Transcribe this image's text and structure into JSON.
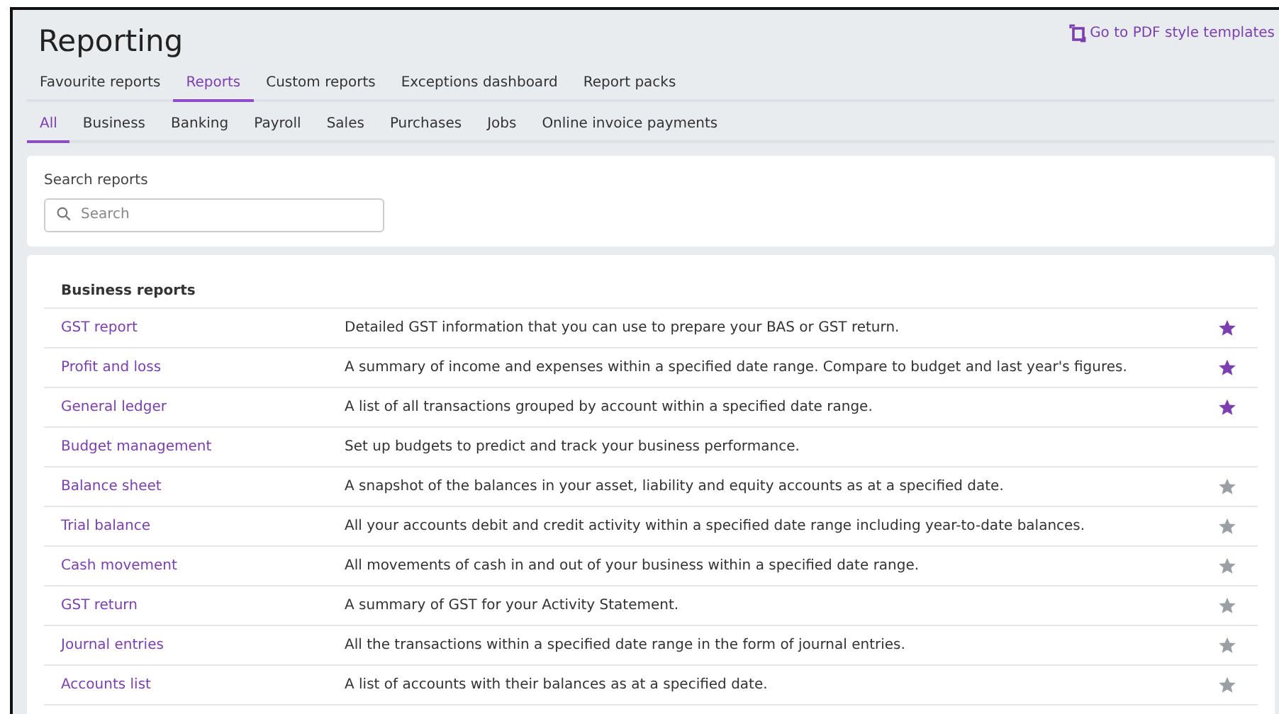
{
  "title": "Reporting",
  "pdf_link": "Go to PDF style templates",
  "tabs": [
    {
      "label": "Favourite reports",
      "selected": false
    },
    {
      "label": "Reports",
      "selected": true
    },
    {
      "label": "Custom reports",
      "selected": false
    },
    {
      "label": "Exceptions dashboard",
      "selected": false
    },
    {
      "label": "Report packs",
      "selected": false
    }
  ],
  "subtabs": [
    {
      "label": "All",
      "selected": true
    },
    {
      "label": "Business",
      "selected": false
    },
    {
      "label": "Banking",
      "selected": false
    },
    {
      "label": "Payroll",
      "selected": false
    },
    {
      "label": "Sales",
      "selected": false
    },
    {
      "label": "Purchases",
      "selected": false
    },
    {
      "label": "Jobs",
      "selected": false
    },
    {
      "label": "Online invoice payments",
      "selected": false
    }
  ],
  "search": {
    "label": "Search reports",
    "placeholder": "Search"
  },
  "section_title": "Business reports",
  "reports": [
    {
      "name": "GST report",
      "description": "Detailed GST information that you can use to prepare your BAS or GST return.",
      "favourite": true
    },
    {
      "name": "Profit and loss",
      "description": "A summary of income and expenses within a specified date range. Compare to budget and last year's figures.",
      "favourite": true
    },
    {
      "name": "General ledger",
      "description": "A list of all transactions grouped by account within a specified date range.",
      "favourite": true
    },
    {
      "name": "Budget management",
      "description": "Set up budgets to predict and track your business performance."
    },
    {
      "name": "Balance sheet",
      "description": "A snapshot of the balances in your asset, liability and equity accounts as at a specified date.",
      "favourite": false
    },
    {
      "name": "Trial balance",
      "description": "All your accounts debit and credit activity within a specified date range including year-to-date balances.",
      "favourite": false
    },
    {
      "name": "Cash movement",
      "description": "All movements of cash in and out of your business within a specified date range.",
      "favourite": false
    },
    {
      "name": "GST return",
      "description": "A summary of GST for your Activity Statement.",
      "favourite": false
    },
    {
      "name": "Journal entries",
      "description": "All the transactions within a specified date range in the form of journal entries.",
      "favourite": false
    },
    {
      "name": "Accounts list",
      "description": "A list of accounts with their balances as at a specified date.",
      "favourite": false
    }
  ]
}
